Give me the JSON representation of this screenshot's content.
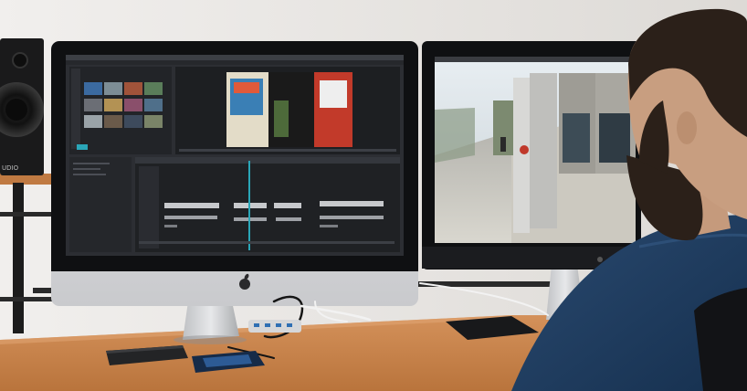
{
  "speaker": {
    "brand_text": "UDIO"
  },
  "colors": {
    "wall": "#e9e7e4",
    "desk": "#c8834a",
    "desk_edge": "#a5642f",
    "monitor_bezel": "#111214",
    "monitor_chin": "#d9dadc",
    "editor_bg": "#2c2e33",
    "timeline_accent": "#2aa6b8",
    "sweater": "#1f3a5c",
    "hair": "#2b2019"
  }
}
